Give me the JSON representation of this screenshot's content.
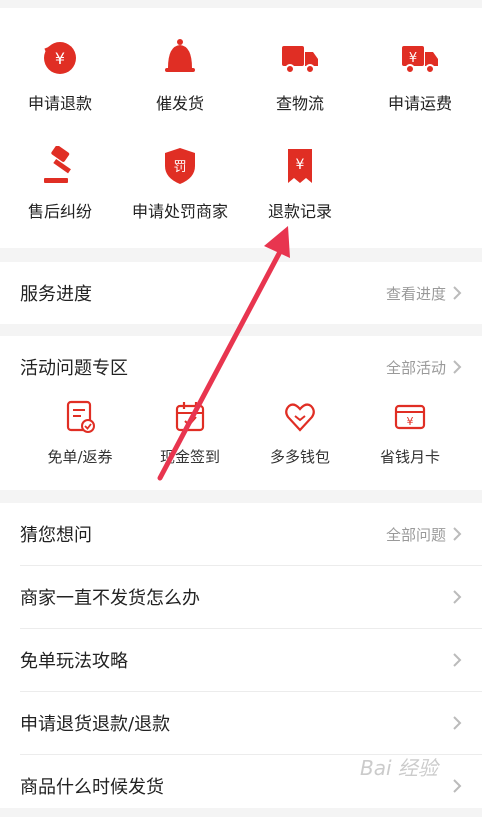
{
  "service_grid": [
    {
      "label": "申请退款",
      "icon": "refund-yen-icon"
    },
    {
      "label": "催发货",
      "icon": "bell-icon"
    },
    {
      "label": "查物流",
      "icon": "truck-icon"
    },
    {
      "label": "申请运费",
      "icon": "freight-yen-truck-icon"
    },
    {
      "label": "售后纠纷",
      "icon": "gavel-icon"
    },
    {
      "label": "申请处罚商家",
      "icon": "penalty-shield-icon"
    },
    {
      "label": "退款记录",
      "icon": "refund-record-icon"
    }
  ],
  "progress": {
    "title": "服务进度",
    "link": "查看进度"
  },
  "activity": {
    "title": "活动问题专区",
    "link": "全部活动",
    "items": [
      {
        "label": "免单/返券",
        "icon": "coupon-doc-icon"
      },
      {
        "label": "现金签到",
        "icon": "calendar-check-icon"
      },
      {
        "label": "多多钱包",
        "icon": "heart-wallet-icon"
      },
      {
        "label": "省钱月卡",
        "icon": "yen-card-icon"
      }
    ]
  },
  "faq": {
    "title": "猜您想问",
    "link": "全部问题",
    "questions": [
      "商家一直不发货怎么办",
      "免单玩法攻略",
      "申请退货退款/退款",
      "商品什么时候发货"
    ]
  },
  "watermark": "Bai 经验",
  "colors": {
    "accent": "#e02e24",
    "annotation_arrow": "#e8354f",
    "link_gray": "#9a9a9a"
  }
}
